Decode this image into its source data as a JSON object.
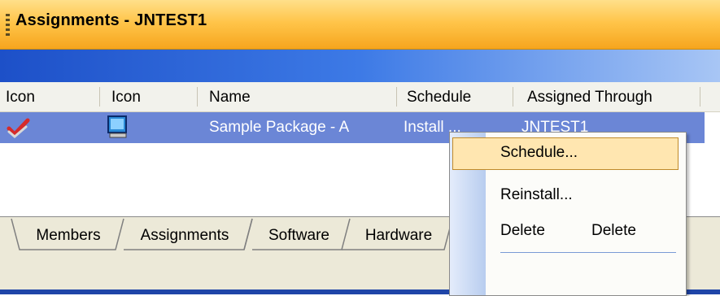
{
  "window": {
    "title": "Assignments - JNTEST1"
  },
  "columns": [
    "Icon",
    "Icon",
    "Name",
    "Schedule",
    "Assigned Through"
  ],
  "row": {
    "name": "Sample Package - A",
    "schedule": "Install ...",
    "assigned_through": "JNTEST1"
  },
  "tabs": [
    "Members",
    "Assignments",
    "Software",
    "Hardware"
  ],
  "context_menu": {
    "items": [
      {
        "label": "Schedule...",
        "highlighted": true
      },
      {
        "label": "Reinstall...",
        "highlighted": false
      },
      {
        "label": "Delete",
        "shortcut": "Delete",
        "highlighted": false
      }
    ]
  },
  "colors": {
    "title_gradient_top": "#ffe08a",
    "title_gradient_bottom": "#f6a51e",
    "selection": "#6b86d6",
    "menu_highlight": "#ffe6b0"
  }
}
